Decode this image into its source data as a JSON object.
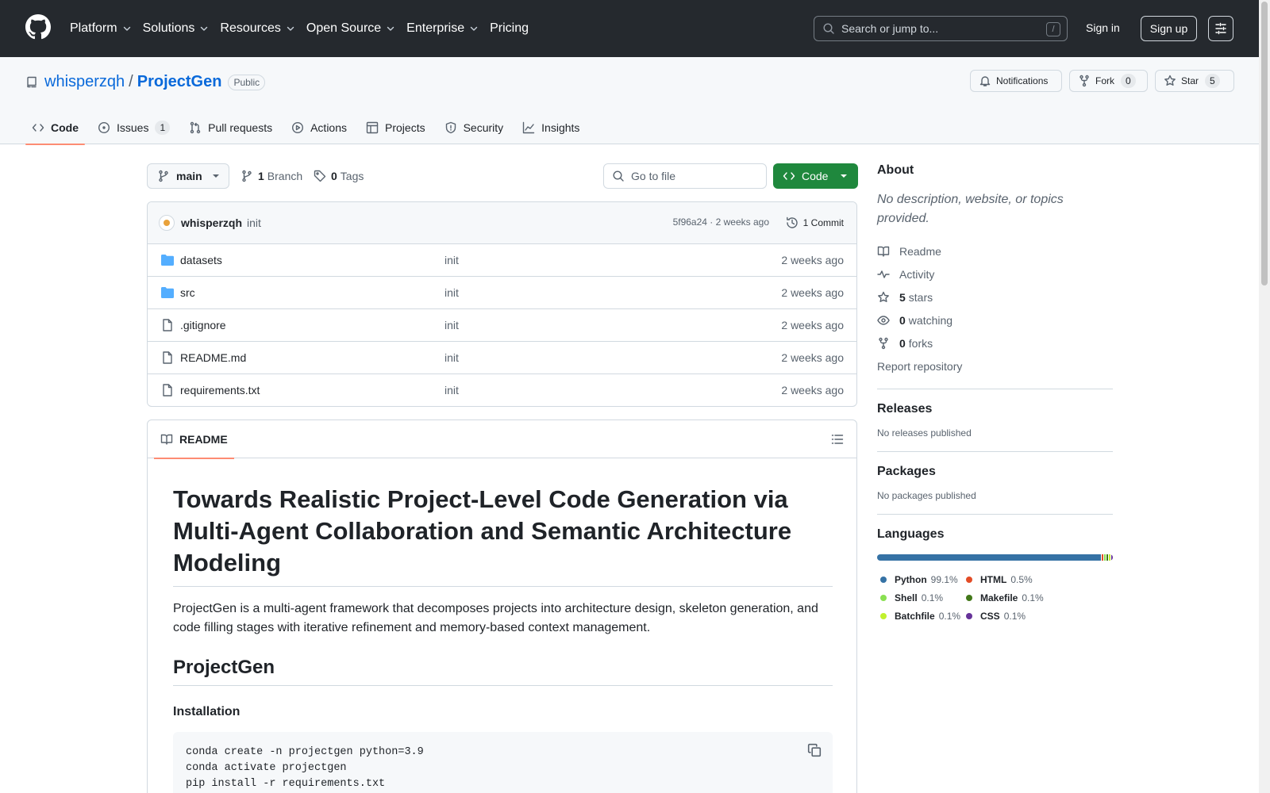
{
  "header": {
    "nav": [
      {
        "label": "Platform",
        "dropdown": true
      },
      {
        "label": "Solutions",
        "dropdown": true
      },
      {
        "label": "Resources",
        "dropdown": true
      },
      {
        "label": "Open Source",
        "dropdown": true
      },
      {
        "label": "Enterprise",
        "dropdown": true
      },
      {
        "label": "Pricing",
        "dropdown": false
      }
    ],
    "search_placeholder": "Search or jump to...",
    "search_shortcut": "/",
    "sign_in": "Sign in",
    "sign_up": "Sign up"
  },
  "repo": {
    "owner": "whisperzqh",
    "separator": "/",
    "name": "ProjectGen",
    "visibility": "Public",
    "notifications_label": "Notifications",
    "fork_label": "Fork",
    "fork_count": "0",
    "star_label": "Star",
    "star_count": "5"
  },
  "tabs": [
    {
      "label": "Code",
      "icon": "code-icon",
      "selected": true,
      "count": ""
    },
    {
      "label": "Issues",
      "icon": "issue-icon",
      "selected": false,
      "count": "1"
    },
    {
      "label": "Pull requests",
      "icon": "pull-request-icon",
      "selected": false,
      "count": ""
    },
    {
      "label": "Actions",
      "icon": "play-icon",
      "selected": false,
      "count": ""
    },
    {
      "label": "Projects",
      "icon": "table-icon",
      "selected": false,
      "count": ""
    },
    {
      "label": "Security",
      "icon": "shield-icon",
      "selected": false,
      "count": ""
    },
    {
      "label": "Insights",
      "icon": "graph-icon",
      "selected": false,
      "count": ""
    }
  ],
  "branchbar": {
    "branch": "main",
    "branch_count": "1",
    "branch_label": "Branch",
    "tag_count": "0",
    "tag_label": "Tags",
    "gofile_placeholder": "Go to file",
    "code_button": "Code"
  },
  "commit": {
    "user": "whisperzqh",
    "message": "init",
    "sha_time": "5f96a24 · 2 weeks ago",
    "commits": "1 Commit"
  },
  "files": [
    {
      "name": "datasets",
      "type": "folder",
      "message": "init",
      "date": "2 weeks ago"
    },
    {
      "name": "src",
      "type": "folder",
      "message": "init",
      "date": "2 weeks ago"
    },
    {
      "name": ".gitignore",
      "type": "file",
      "message": "init",
      "date": "2 weeks ago"
    },
    {
      "name": "README.md",
      "type": "file",
      "message": "init",
      "date": "2 weeks ago"
    },
    {
      "name": "requirements.txt",
      "type": "file",
      "message": "init",
      "date": "2 weeks ago"
    }
  ],
  "readme": {
    "tab": "README",
    "title": "Towards Realistic Project-Level Code Generation via Multi-Agent Collaboration and Semantic Architecture Modeling",
    "intro": "ProjectGen is a multi-agent framework that decomposes projects into architecture design, skeleton generation, and code filling stages with iterative refinement and memory-based context management.",
    "h2": "ProjectGen",
    "h3": "Installation",
    "code_lines": [
      "conda create -n projectgen python=3.9",
      "conda activate projectgen",
      "pip install -r requirements.txt"
    ]
  },
  "sidebar": {
    "about": "About",
    "description": "No description, website, or topics provided.",
    "links": [
      {
        "icon": "book-icon",
        "count": "",
        "label": "Readme"
      },
      {
        "icon": "pulse-icon",
        "count": "",
        "label": "Activity"
      },
      {
        "icon": "star-icon",
        "count": "5",
        "label": "stars"
      },
      {
        "icon": "eye-icon",
        "count": "0",
        "label": "watching"
      },
      {
        "icon": "fork-icon",
        "count": "0",
        "label": "forks"
      }
    ],
    "report": "Report repository",
    "releases_title": "Releases",
    "releases_text": "No releases published",
    "packages_title": "Packages",
    "packages_text": "No packages published",
    "languages_title": "Languages",
    "languages": [
      {
        "name": "Python",
        "percent": "99.1%",
        "value": 99.1,
        "color": "#3572A5"
      },
      {
        "name": "HTML",
        "percent": "0.5%",
        "value": 0.5,
        "color": "#e34c26"
      },
      {
        "name": "Shell",
        "percent": "0.1%",
        "value": 0.1,
        "color": "#89e051"
      },
      {
        "name": "Makefile",
        "percent": "0.1%",
        "value": 0.1,
        "color": "#427819"
      },
      {
        "name": "Batchfile",
        "percent": "0.1%",
        "value": 0.1,
        "color": "#C1F12E"
      },
      {
        "name": "CSS",
        "percent": "0.1%",
        "value": 0.1,
        "color": "#663399"
      }
    ]
  }
}
